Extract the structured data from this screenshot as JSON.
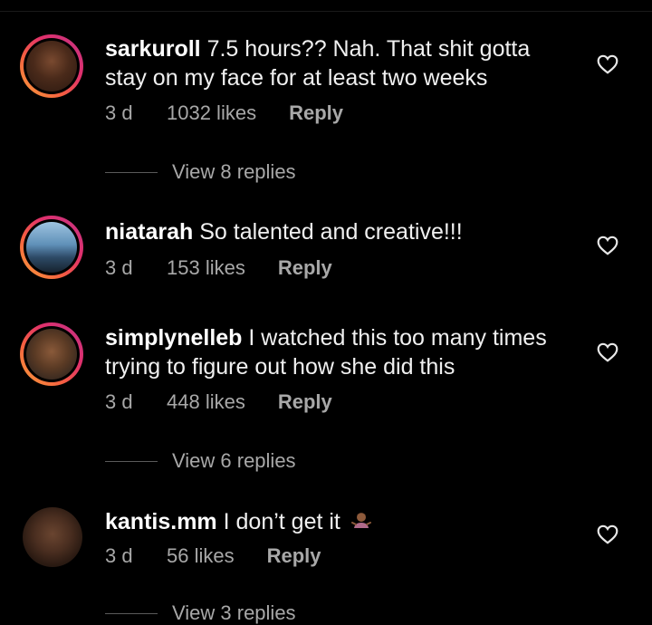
{
  "comments": [
    {
      "username": "sarkuroll",
      "text": "7.5 hours?? Nah. That shit gotta stay on my face for at least two weeks",
      "time": "3 d",
      "likes": "1032 likes",
      "reply": "Reply",
      "view_replies": "View 8 replies",
      "has_story": true
    },
    {
      "username": "niatarah",
      "text": "So talented and creative!!!",
      "time": "3 d",
      "likes": "153 likes",
      "reply": "Reply",
      "has_story": true
    },
    {
      "username": "simplynelleb",
      "text": "I watched this too many times trying to figure out how she did this",
      "time": "3 d",
      "likes": "448 likes",
      "reply": "Reply",
      "view_replies": "View 6 replies",
      "has_story": true
    },
    {
      "username": "kantis.mm",
      "text": "I don’t get it",
      "emoji": "person-shrugging-icon",
      "time": "3 d",
      "likes": "56 likes",
      "reply": "Reply",
      "view_replies": "View 3 replies",
      "has_story": false
    }
  ],
  "colors": {
    "background": "#000000",
    "primary_text": "#f5f5f5",
    "secondary_text": "#a8a8a8",
    "story_ring_start": "#f9a23b",
    "story_ring_end": "#c13584"
  }
}
